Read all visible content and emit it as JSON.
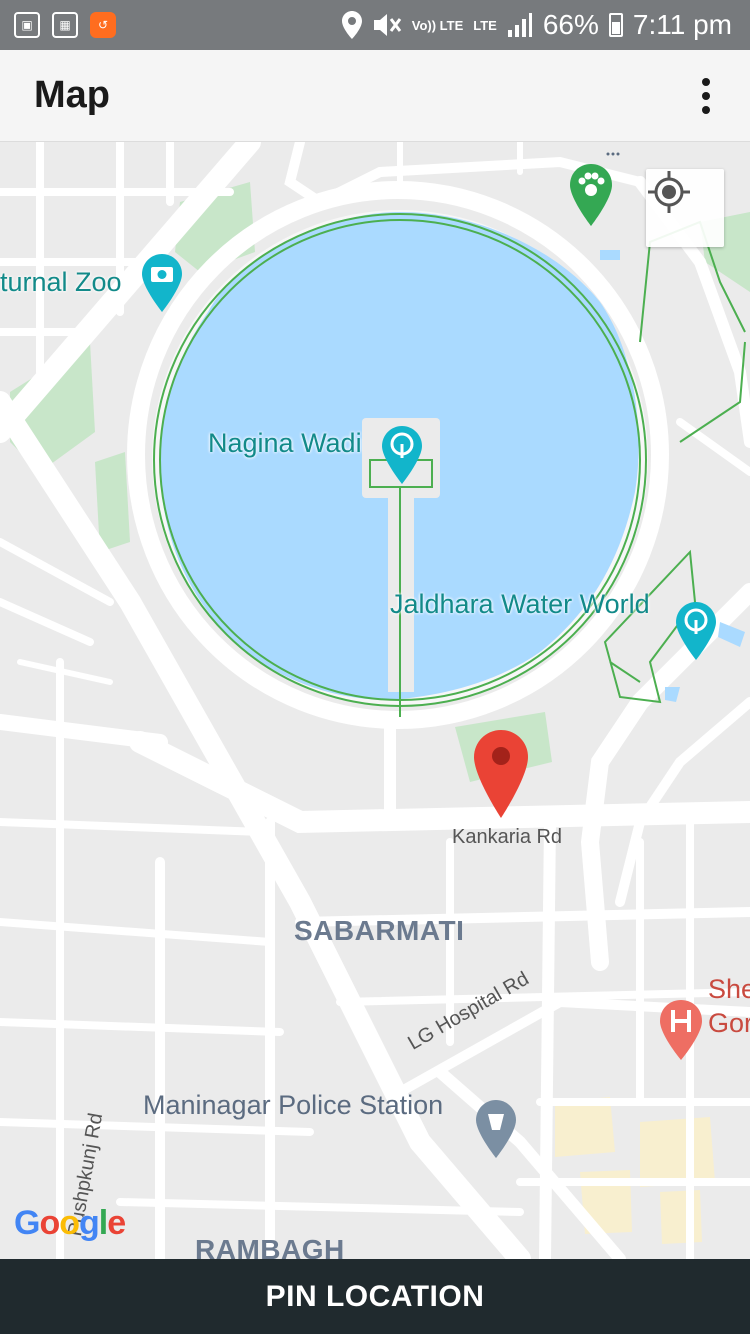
{
  "status_bar": {
    "volte": "Vo)) LTE",
    "lte": "LTE",
    "battery": "66%",
    "time": "7:11 pm",
    "icons": [
      "image-icon",
      "calculator-icon",
      "app-icon",
      "location-icon",
      "mute-icon",
      "signal-icon",
      "battery-icon"
    ]
  },
  "app_bar": {
    "title": "Map",
    "menu_icon": "more-vert-icon"
  },
  "map": {
    "labels": {
      "zoo": "turnal Zoo",
      "nagina_wadi": "Nagina Wadi",
      "jaldhara": "Jaldhara Water World",
      "kankaria_rd": "Kankaria Rd",
      "sabarmati": "SABARMATI",
      "lg_hospital_rd": "LG Hospital Rd",
      "police_station": "Maninagar Police Station",
      "pushpkunj_rd": "Pushpkunj Rd",
      "rambagh": "RAMBAGH",
      "hospital_line1": "She",
      "hospital_line2": "Gor"
    },
    "google": "Google",
    "colors": {
      "lake": "#aadaff",
      "park": "#c8e6c9",
      "road": "#ffffff",
      "path": "#4caf50",
      "marker": "#ea4335",
      "poi_teal": "#12b5cb"
    }
  },
  "action": {
    "pin_label": "PIN LOCATION"
  }
}
